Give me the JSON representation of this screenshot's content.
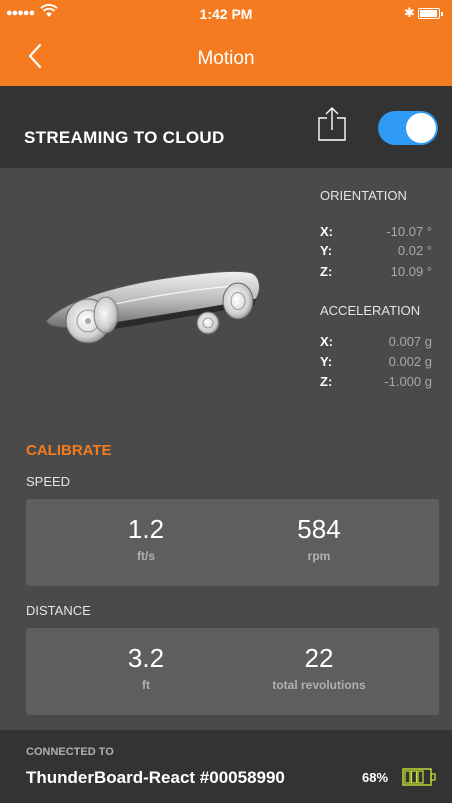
{
  "status_bar": {
    "signal": "●●●●●",
    "time": "1:42 PM",
    "bluetooth": "✱"
  },
  "nav": {
    "title": "Motion",
    "back_icon": "chevron-left"
  },
  "stream": {
    "label": "STREAMING TO CLOUD",
    "toggle_on": true,
    "share_icon": "share-icon",
    "toggle_color": "#2f9bf5"
  },
  "orientation": {
    "heading": "ORIENTATION",
    "rows": [
      {
        "axis": "X:",
        "value": "-10.07 °"
      },
      {
        "axis": "Y:",
        "value": "0.02 °"
      },
      {
        "axis": "Z:",
        "value": "10.09 °"
      }
    ]
  },
  "acceleration": {
    "heading": "ACCELERATION",
    "rows": [
      {
        "axis": "X:",
        "value": "0.007 g"
      },
      {
        "axis": "Y:",
        "value": "0.002 g"
      },
      {
        "axis": "Z:",
        "value": "-1.000 g"
      }
    ]
  },
  "calibrate_label": "CALIBRATE",
  "speed": {
    "label": "SPEED",
    "metrics": [
      {
        "value": "1.2",
        "unit": "ft/s"
      },
      {
        "value": "584",
        "unit": "rpm"
      }
    ]
  },
  "distance": {
    "label": "DISTANCE",
    "metrics": [
      {
        "value": "3.2",
        "unit": "ft"
      },
      {
        "value": "22",
        "unit": "total revolutions"
      }
    ]
  },
  "footer": {
    "connected_label": "CONNECTED TO",
    "device_name": "ThunderBoard-React #00058990",
    "battery_percent": "68%",
    "battery_level": 0.68,
    "battery_color": "#c6e636"
  },
  "colors": {
    "accent": "#f47b20",
    "dark_bar": "#333333",
    "background": "#4a4a4a",
    "card": "#5e5e5e"
  }
}
